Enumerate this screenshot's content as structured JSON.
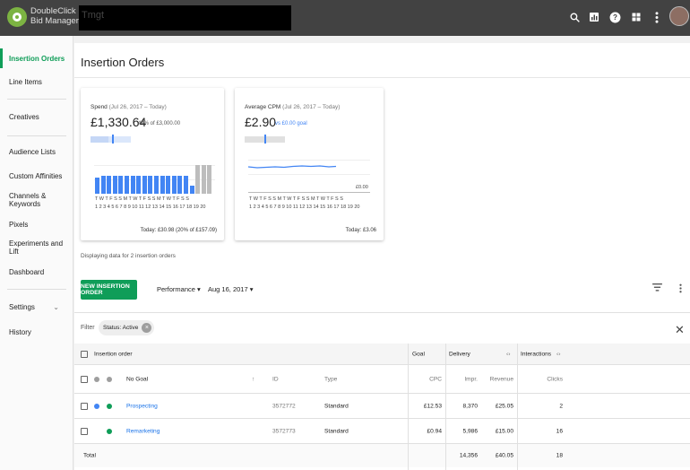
{
  "app": {
    "brand_line1": "DoubleClick",
    "brand_line2": "Bid Manager",
    "breadcrumb": "Tmgt"
  },
  "topbar_icons": [
    "search-icon",
    "reports-icon",
    "help-icon",
    "apps-icon",
    "more-vert-icon",
    "avatar"
  ],
  "sidebar": {
    "items": [
      {
        "label": "Insertion Orders",
        "active": true
      },
      {
        "label": "Line Items"
      },
      {
        "label": "Creatives"
      },
      {
        "label": "Audience Lists"
      },
      {
        "label": "Custom Affinities"
      },
      {
        "label": "Channels & Keywords"
      },
      {
        "label": "Pixels"
      },
      {
        "label": "Experiments and Lift"
      },
      {
        "label": "Dashboard"
      },
      {
        "label": "Settings"
      },
      {
        "label": "History"
      }
    ]
  },
  "page": {
    "title": "Insertion Orders",
    "caption": "Displaying data for 2 insertion orders"
  },
  "spend_card": {
    "label": "Spend",
    "range": "(Jul 26, 2017 – Today)",
    "value": "£1,330.64",
    "sub": "44% of £3,000.00",
    "days_row1": "T W T F S S M T W T F S S M T W T F S S",
    "days_row2": "1 2 3 4 5 6 7 8 9 10 11 12 13 14 15 16 17 18 19 20",
    "today": "Today: £30.98 (20% of £157.09)",
    "pace_fraction": 0.44,
    "bars": [
      0.55,
      0.62,
      0.62,
      0.62,
      0.62,
      0.62,
      0.62,
      0.62,
      0.62,
      0.62,
      0.62,
      0.62,
      0.62,
      0.62,
      0.62,
      0.62,
      0.28,
      1.0,
      1.0,
      1.0
    ],
    "bars_future_from": 17
  },
  "cpm_card": {
    "label": "Average CPM",
    "range": "(Jul 26, 2017 – Today)",
    "value": "£2.90",
    "sub": "vs £0.00 goal",
    "axis_value": "£0.00",
    "days_row1": "T W T F S S M T W T F S S M T W T F S S",
    "days_row2": "1 2 3 4 5 6 7 8 9 10 11 12 13 14 15 16 17 18 19 20",
    "today": "Today: £3.06"
  },
  "toolbar": {
    "new_button": "NEW INSERTION ORDER",
    "view_select": "Performance",
    "date_select": "Aug 16, 2017"
  },
  "filter": {
    "label": "Filter",
    "chip": "Status: Active"
  },
  "table": {
    "group_headers": {
      "name": "Insertion order",
      "goal": "Goal",
      "delivery": "Delivery",
      "interactions": "Interactions"
    },
    "columns": {
      "name": "No Goal",
      "id": "ID",
      "type": "Type",
      "cpc": "CPC",
      "impr": "Impr.",
      "revenue": "Revenue",
      "clicks": "Clicks"
    },
    "rows": [
      {
        "name": "Prospecting",
        "id": "3572772",
        "type": "Standard",
        "cpc": "£12.53",
        "impr": "8,370",
        "revenue": "£25.05",
        "clicks": "2"
      },
      {
        "name": "Remarketing",
        "id": "3572773",
        "type": "Standard",
        "cpc": "£0.94",
        "impr": "5,986",
        "revenue": "£15.00",
        "clicks": "16"
      }
    ],
    "total": {
      "label": "Total",
      "impr": "14,356",
      "revenue": "£40.05",
      "clicks": "18"
    }
  },
  "colors": {
    "accent": "#0f9d58",
    "link": "#1a73e8",
    "bar": "#4285f4",
    "topbar": "#424242"
  }
}
